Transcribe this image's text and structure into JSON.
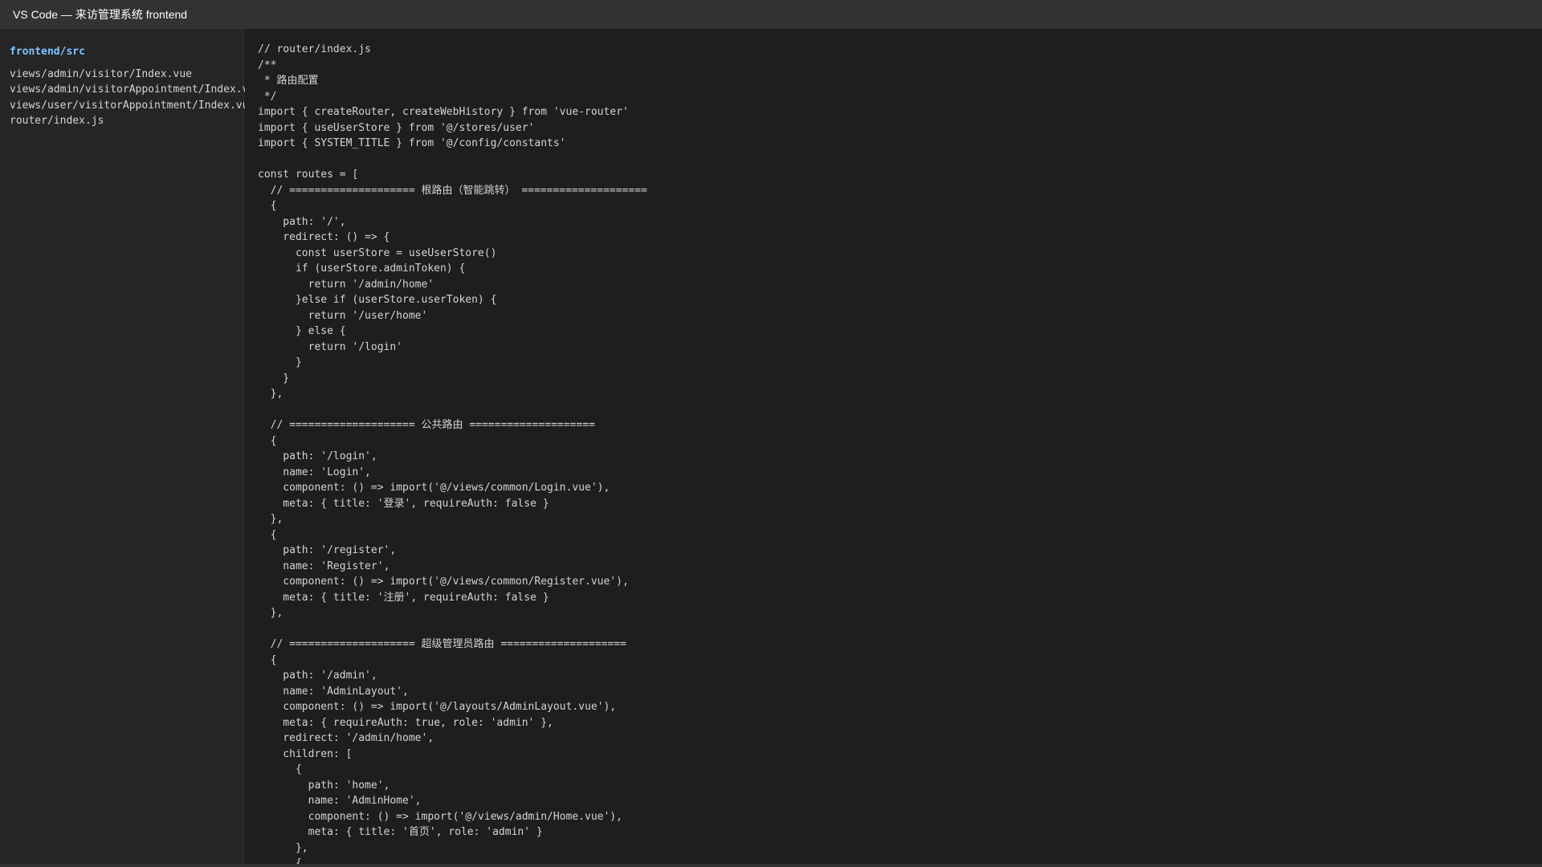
{
  "window": {
    "title": "VS Code — 来访管理系统 frontend"
  },
  "sidebar": {
    "title": "frontend/src",
    "files": [
      "views/admin/visitor/Index.vue",
      "views/admin/visitorAppointment/Index.vue",
      "views/user/visitorAppointment/Index.vue",
      "router/index.js"
    ]
  },
  "editor": {
    "lines": [
      "// router/index.js",
      "/**",
      " * 路由配置",
      " */",
      "import { createRouter, createWebHistory } from 'vue-router'",
      "import { useUserStore } from '@/stores/user'",
      "import { SYSTEM_TITLE } from '@/config/constants'",
      "",
      "const routes = [",
      "  // ==================== 根路由（智能跳转） ====================",
      "  {",
      "    path: '/',",
      "    redirect: () => {",
      "      const userStore = useUserStore()",
      "      if (userStore.adminToken) {",
      "        return '/admin/home'",
      "      }else if (userStore.userToken) {",
      "        return '/user/home'",
      "      } else {",
      "        return '/login'",
      "      }",
      "    }",
      "  },",
      "",
      "  // ==================== 公共路由 ====================",
      "  {",
      "    path: '/login',",
      "    name: 'Login',",
      "    component: () => import('@/views/common/Login.vue'),",
      "    meta: { title: '登录', requireAuth: false }",
      "  },",
      "  {",
      "    path: '/register',",
      "    name: 'Register',",
      "    component: () => import('@/views/common/Register.vue'),",
      "    meta: { title: '注册', requireAuth: false }",
      "  },",
      "",
      "  // ==================== 超级管理员路由 ====================",
      "  {",
      "    path: '/admin',",
      "    name: 'AdminLayout',",
      "    component: () => import('@/layouts/AdminLayout.vue'),",
      "    meta: { requireAuth: true, role: 'admin' },",
      "    redirect: '/admin/home',",
      "    children: [",
      "      {",
      "        path: 'home',",
      "        name: 'AdminHome',",
      "        component: () => import('@/views/admin/Home.vue'),",
      "        meta: { title: '首页', role: 'admin' }",
      "      },",
      "      {"
    ]
  }
}
